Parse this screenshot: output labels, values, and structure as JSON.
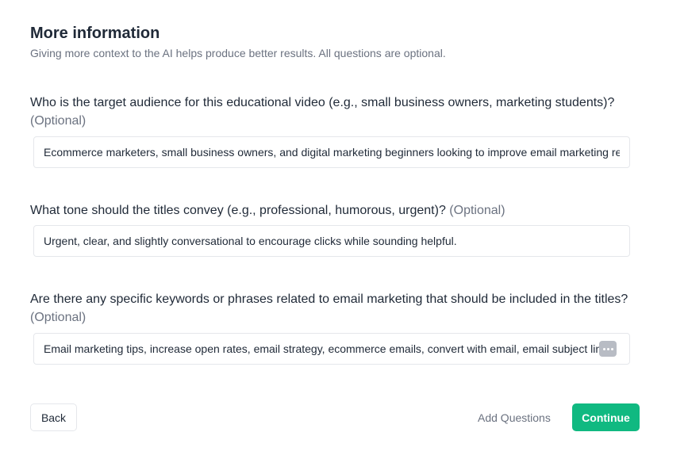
{
  "header": {
    "title": "More information",
    "subtitle": "Giving more context to the AI helps produce better results. All questions are optional."
  },
  "questions": [
    {
      "text": "Who is the target audience for this educational video (e.g., small business owners, marketing students)?",
      "optional_label": "(Optional)",
      "answer": "Ecommerce marketers, small business owners, and digital marketing beginners looking to improve email marketing results."
    },
    {
      "text": "What tone should the titles convey (e.g., professional, humorous, urgent)?",
      "optional_label": "(Optional)",
      "answer": "Urgent, clear, and slightly conversational to encourage clicks while sounding helpful."
    },
    {
      "text": "Are there any specific keywords or phrases related to email marketing that should be included in the titles?",
      "optional_label": "(Optional)",
      "answer": "Email marketing tips, increase open rates, email strategy, ecommerce emails, convert with email, email subject lines"
    }
  ],
  "footer": {
    "back_label": "Back",
    "add_questions_label": "Add Questions",
    "continue_label": "Continue"
  },
  "icons": {
    "grammar_badge": "more-dots-icon"
  },
  "colors": {
    "accent": "#10b981",
    "muted_text": "#6b7280",
    "border": "#e5e7eb"
  }
}
